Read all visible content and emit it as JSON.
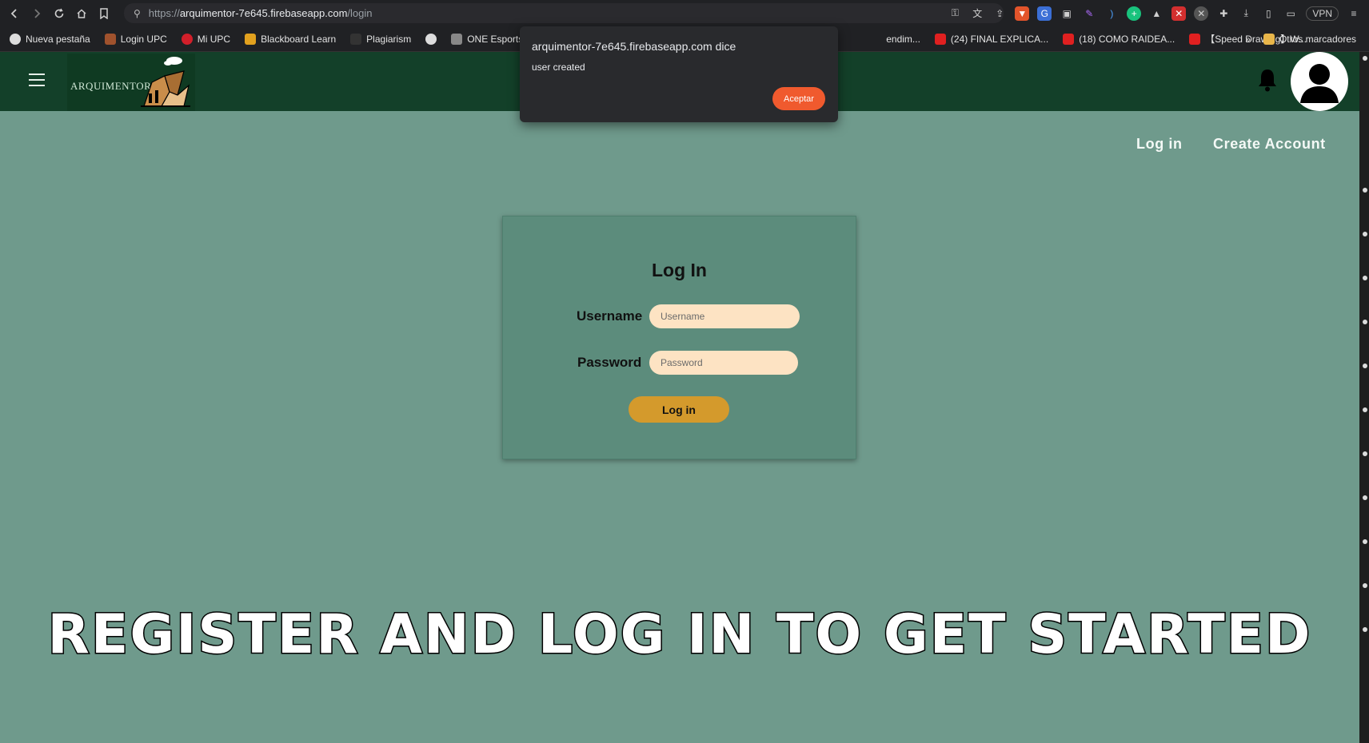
{
  "browser": {
    "url_scheme": "https://",
    "url_host": "arquimentor-7e645.firebaseapp.com",
    "url_path": "/login",
    "vpn_label": "VPN",
    "bookmarks": [
      "Nueva pestaña",
      "Login UPC",
      "Mi UPC",
      "Blackboard Learn",
      "Plagiarism",
      "ONE Esports Singa..."
    ],
    "bookmarks_partial": "endim...",
    "bookmarks_yt": [
      "(24) FINAL EXPLICA...",
      "(18) COMO RAIDEA...",
      "【Speed Drawing】W..."
    ],
    "overflow_label": "»",
    "other_bookmarks": "Otros marcadores"
  },
  "dialog": {
    "title": "arquimentor-7e645.firebaseapp.com dice",
    "message": "user created",
    "accept_label": "Aceptar"
  },
  "header": {
    "logo_text": "ARQUIMENTOR"
  },
  "nav": {
    "login_label": "Log in",
    "create_account_label": "Create Account"
  },
  "login_form": {
    "title": "Log In",
    "username_label": "Username",
    "username_placeholder": "Username",
    "password_label": "Password",
    "password_placeholder": "Password",
    "submit_label": "Log in"
  },
  "banner": {
    "text": "REGISTER AND LOG IN TO GET STARTED"
  }
}
